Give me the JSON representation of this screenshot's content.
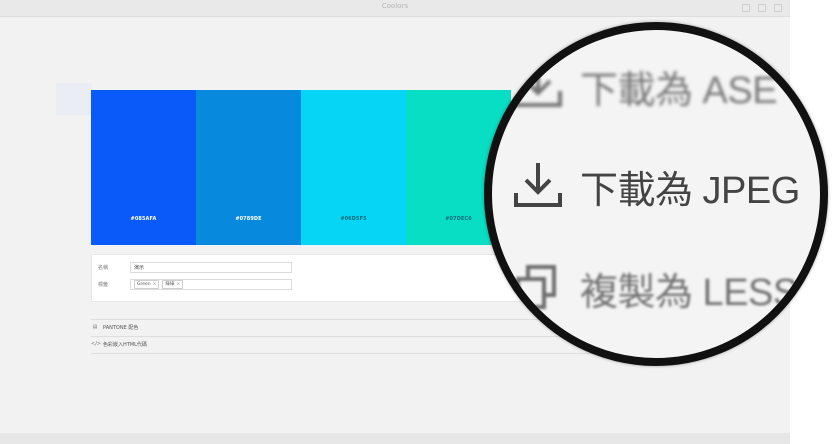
{
  "window": {
    "title": "Coolors"
  },
  "palette": {
    "swatches": [
      {
        "hex": "#085AFA",
        "color": "#0a5af9"
      },
      {
        "hex": "#0789DE",
        "color": "#0789de"
      },
      {
        "hex": "#06D5F5",
        "color": "#06d5f5"
      },
      {
        "hex": "#07DEC6",
        "color": "#07dec3"
      }
    ]
  },
  "form": {
    "name_label": "名稱",
    "name_value": "演示",
    "tags_label": "標籤",
    "tags": [
      "Green",
      "綠綠"
    ]
  },
  "lists": {
    "pantone": "PANTONE 配色",
    "code": "色彩嵌入HTML代碼"
  },
  "magnifier": {
    "items": [
      {
        "label": "下載為 ASE",
        "icon": "download-icon"
      },
      {
        "label": "下載為 JPEG",
        "icon": "download-icon"
      },
      {
        "label": "複製為 LESS",
        "icon": "copy-icon"
      }
    ]
  }
}
